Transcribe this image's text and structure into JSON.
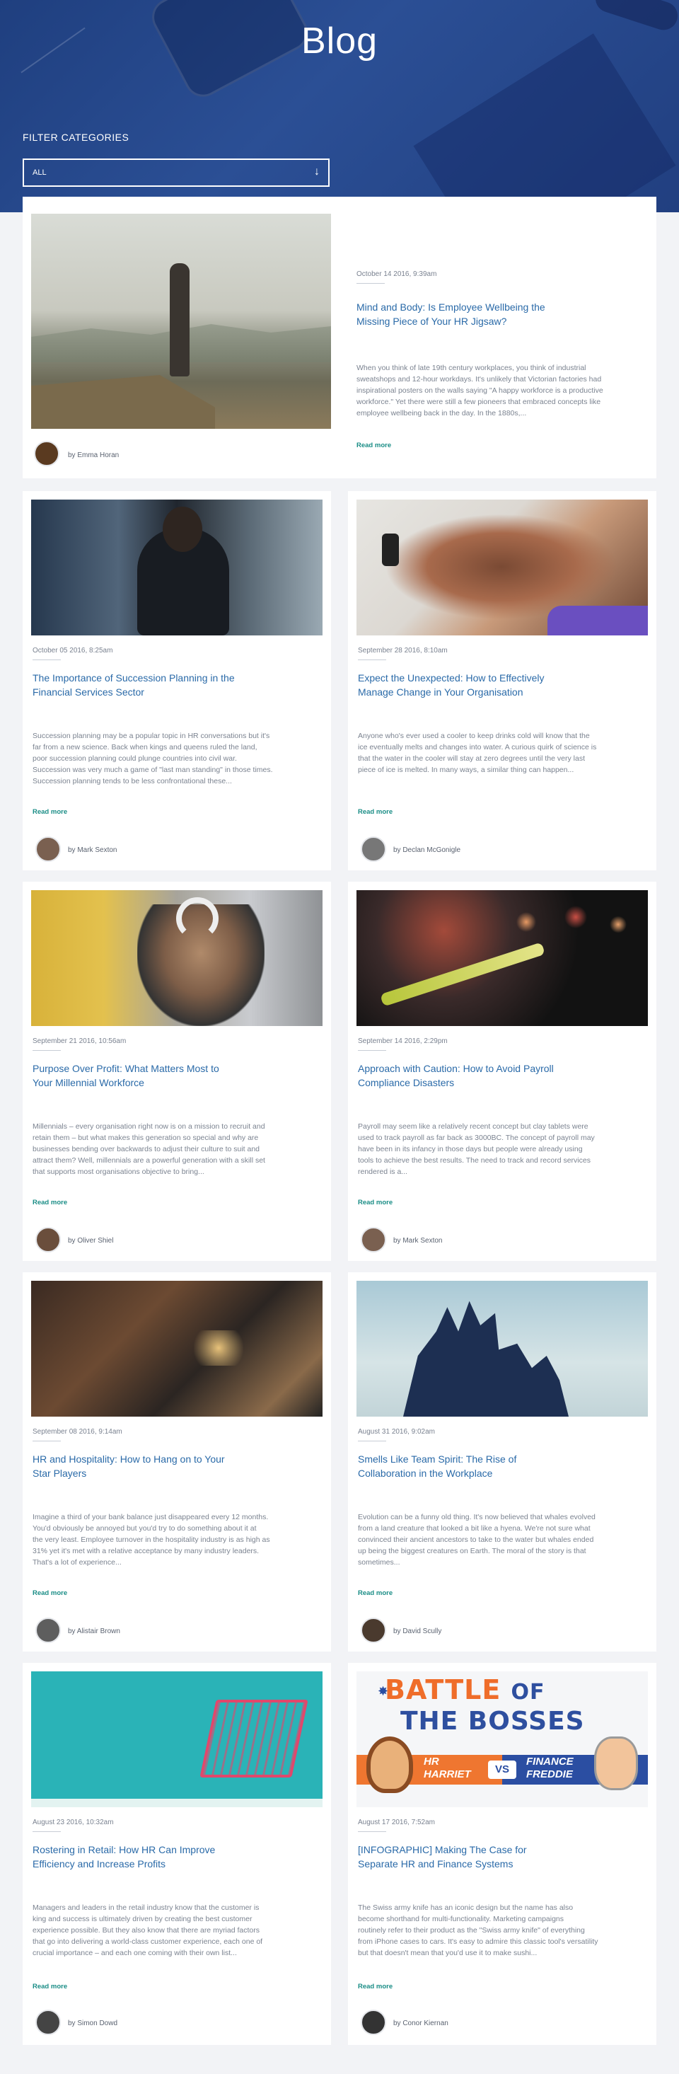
{
  "hero": {
    "title": "Blog"
  },
  "filter": {
    "label": "FILTER CATEGORIES",
    "selected": "ALL",
    "arrow_icon": "arrow-down-icon"
  },
  "read_more": "Read more",
  "posts": [
    {
      "date": "October 14 2016, 9:39am",
      "title_line1": "Mind and Body: Is Employee Wellbeing the",
      "title_line2": "Missing Piece of Your HR Jigsaw?",
      "excerpt": [
        "When you think of late 19th century workplaces, you think of industrial",
        "sweatshops and 12-hour workdays. It's unlikely that Victorian factories had",
        "inspirational posters on the walls saying \"A happy workforce is a productive",
        "workforce.\" Yet there were still a few pioneers that embraced concepts like",
        "employee wellbeing back in the day. In the 1880s,..."
      ],
      "author": "by Emma Horan"
    },
    {
      "date": "October 05 2016, 8:25am",
      "title_line1": "The Importance of Succession Planning in the",
      "title_line2": "Financial Services Sector",
      "excerpt": [
        "Succession planning may be a popular topic in HR conversations but it's",
        "far from a new science. Back when kings and queens ruled the land,",
        "poor succession planning could plunge countries into civil war.",
        "Succession was very much a game of \"last man standing\" in those times.",
        "Succession planning tends to be less confrontational these..."
      ],
      "author": "by Mark Sexton"
    },
    {
      "date": "September 28 2016, 8:10am",
      "title_line1": "Expect the Unexpected: How to Effectively",
      "title_line2": "Manage Change in Your Organisation",
      "excerpt": [
        "Anyone who's ever used a cooler to keep drinks cold will know that the",
        "ice eventually melts and changes into water. A curious quirk of science is",
        "that the water in the cooler will stay at zero degrees until the very last",
        "piece of ice is melted. In many ways, a similar thing can happen..."
      ],
      "author": "by Declan McGonigle"
    },
    {
      "date": "September 21 2016, 10:56am",
      "title_line1": "Purpose Over Profit: What Matters Most to",
      "title_line2": "Your Millennial Workforce",
      "excerpt": [
        "Millennials – every organisation right now is on a mission to recruit and",
        "retain them – but what makes this generation so special and why are",
        "businesses bending over backwards to adjust their culture to suit and",
        "attract them? Well, millennials are a powerful generation with a skill set",
        "that supports most organisations objective to bring..."
      ],
      "author": "by Oliver Shiel"
    },
    {
      "date": "September 14 2016, 2:29pm",
      "title_line1": "Approach with Caution: How to Avoid Payroll",
      "title_line2": "Compliance Disasters",
      "excerpt": [
        "Payroll may seem like a relatively recent concept but clay tablets were",
        "used to track payroll as far back as 3000BC. The concept of payroll may",
        "have been in its infancy in those days but people were already using",
        "tools to achieve the best results. The need to track and record services",
        "rendered is a..."
      ],
      "author": "by Mark Sexton"
    },
    {
      "date": "September 08 2016, 9:14am",
      "title_line1": "HR and Hospitality: How to Hang on to Your",
      "title_line2": "Star Players",
      "excerpt": [
        "Imagine a third of your bank balance just disappeared every 12 months.",
        "You'd obviously be annoyed but you'd try to do something about it at",
        "the very least. Employee turnover in the hospitality industry is as high as",
        "31% yet it's met with a relative acceptance by many industry leaders.",
        "That's a lot of experience..."
      ],
      "author": "by Alistair Brown"
    },
    {
      "date": "August 31 2016, 9:02am",
      "title_line1": "Smells Like Team Spirit: The Rise of",
      "title_line2": "Collaboration in the Workplace",
      "excerpt": [
        "Evolution can be a funny old thing. It's now believed that whales evolved",
        "from a land creature that looked a bit like a hyena. We're not sure what",
        "convinced their ancient ancestors to take to the water but whales ended",
        "up being the biggest creatures on Earth. The moral of the story is that",
        "sometimes..."
      ],
      "author": "by David Scully"
    },
    {
      "date": "August 23 2016, 10:32am",
      "title_line1": "Rostering in Retail: How HR Can Improve",
      "title_line2": "Efficiency and Increase Profits",
      "excerpt": [
        "Managers and leaders in the retail industry know that the customer is",
        "king and success is ultimately driven by creating the best customer",
        "experience possible. But they also know that there are myriad factors",
        "that go into delivering a world-class customer experience, each one of",
        "crucial importance – and each one coming with their own list..."
      ],
      "author": "by Simon Dowd"
    },
    {
      "date": "August 17 2016, 7:52am",
      "title_line1": "[INFOGRAPHIC] Making The Case for",
      "title_line2": "Separate HR and Finance Systems",
      "excerpt": [
        "The Swiss army knife has an iconic design but the name has also",
        "become shorthand for multi-functionality. Marketing campaigns",
        "routinely refer to their product as the \"Swiss army knife\" of everything",
        "from iPhone cases to cars. It's easy to admire this classic tool's versatility",
        "but that doesn't mean that you'd use it to make sushi..."
      ],
      "author": "by Conor Kiernan"
    }
  ],
  "infographic": {
    "line1": "BATTLE",
    "line1b": "OF",
    "line2": "THE BOSSES",
    "left_name_1": "HR",
    "left_name_2": "HARRIET",
    "vs": "VS",
    "right_name_1": "FINANCE",
    "right_name_2": "FREDDIE"
  }
}
